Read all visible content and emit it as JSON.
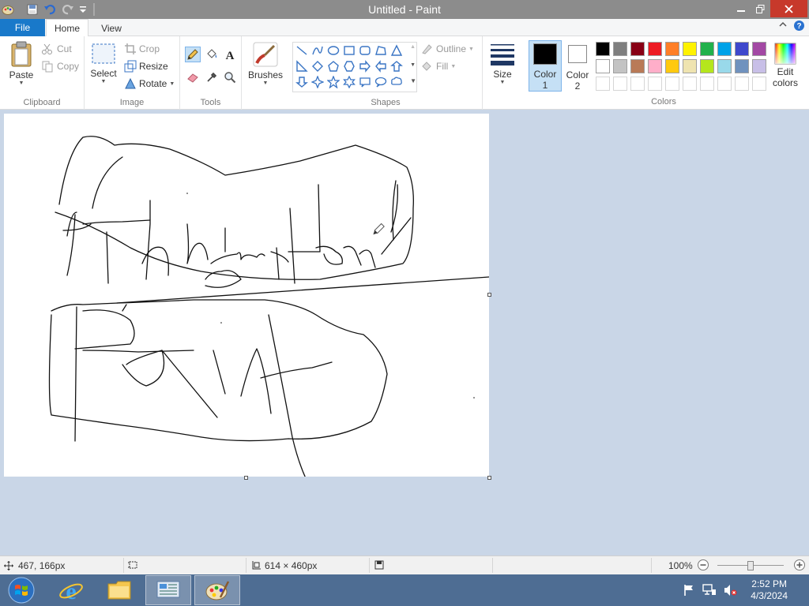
{
  "window": {
    "title": "Untitled - Paint"
  },
  "tabs": {
    "file": "File",
    "home": "Home",
    "view": "View"
  },
  "clipboard": {
    "paste": "Paste",
    "cut": "Cut",
    "copy": "Copy",
    "label": "Clipboard"
  },
  "image": {
    "select": "Select",
    "crop": "Crop",
    "resize": "Resize",
    "rotate": "Rotate",
    "label": "Image"
  },
  "tools": {
    "label": "Tools",
    "selected": "pencil"
  },
  "brushes": {
    "label": "Brushes"
  },
  "shapes": {
    "outline": "Outline",
    "fill": "Fill",
    "label": "Shapes"
  },
  "size": {
    "label": "Size"
  },
  "color1": {
    "label": "Color",
    "num": "1",
    "value": "#000000"
  },
  "color2": {
    "label": "Color",
    "num": "2",
    "value": "#ffffff"
  },
  "colors": {
    "label": "Colors",
    "edit": "Edit",
    "edit2": "colors",
    "row1": [
      "#000000",
      "#7f7f7f",
      "#880015",
      "#ed1c24",
      "#ff7f27",
      "#fff200",
      "#22b14c",
      "#00a2e8",
      "#3f48cc",
      "#a349a4"
    ],
    "row2": [
      "#ffffff",
      "#c3c3c3",
      "#b97a57",
      "#ffaec9",
      "#ffc90e",
      "#efe4b0",
      "#b5e61d",
      "#99d9ea",
      "#7092be",
      "#c8bfe7"
    ]
  },
  "status": {
    "cursor": "467, 166px",
    "size": "614 × 460px",
    "zoom": "100%",
    "zoom_level": 100
  },
  "taskbar": {
    "time": "2:52 PM",
    "date": "4/3/2024"
  }
}
